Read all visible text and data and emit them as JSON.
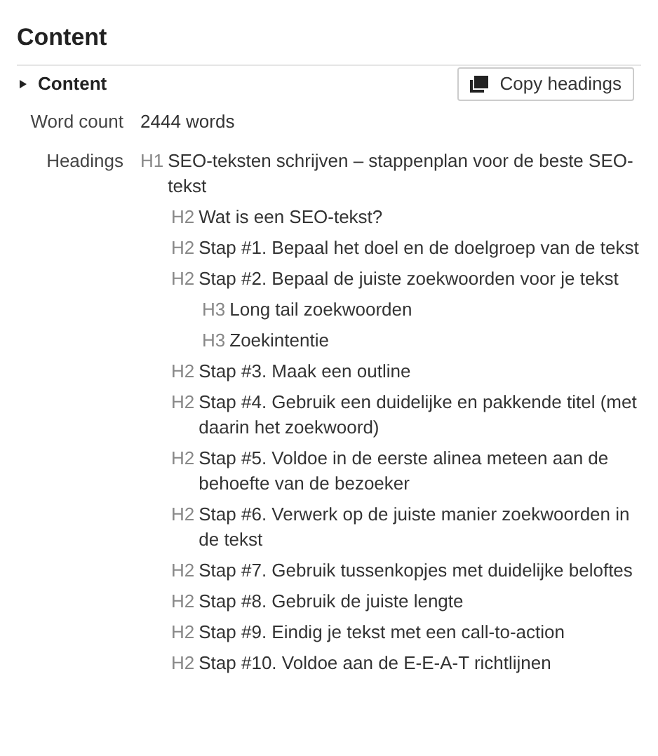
{
  "title": "Content",
  "section": {
    "title": "Content",
    "expanded": false,
    "copy_button": "Copy headings"
  },
  "word_count": {
    "label": "Word count",
    "value": "2444 words"
  },
  "headings": {
    "label": "Headings",
    "items": [
      {
        "tag": "H1",
        "text": "SEO-teksten schrijven – stappenplan voor de beste SEO-tekst",
        "children": [
          {
            "tag": "H2",
            "text": "Wat is een SEO-tekst?"
          },
          {
            "tag": "H2",
            "text": "Stap #1. Bepaal het doel en de doelgroep van de tekst"
          },
          {
            "tag": "H2",
            "text": "Stap #2. Bepaal de juiste zoekwoorden voor je tekst",
            "children": [
              {
                "tag": "H3",
                "text": "Long tail zoekwoorden"
              },
              {
                "tag": "H3",
                "text": "Zoekintentie"
              }
            ]
          },
          {
            "tag": "H2",
            "text": "Stap #3. Maak een outline"
          },
          {
            "tag": "H2",
            "text": "Stap #4. Gebruik een duidelijke en pakkende titel (met daarin het zoekwoord)"
          },
          {
            "tag": "H2",
            "text": "Stap #5. Voldoe in de eerste alinea meteen aan de behoefte van de bezoeker"
          },
          {
            "tag": "H2",
            "text": "Stap #6. Verwerk op de juiste manier zoekwoorden in de tekst"
          },
          {
            "tag": "H2",
            "text": "Stap #7. Gebruik tussenkopjes met duidelijke beloftes"
          },
          {
            "tag": "H2",
            "text": "Stap #8. Gebruik de juiste lengte"
          },
          {
            "tag": "H2",
            "text": "Stap #9. Eindig je tekst met een call-to-action"
          },
          {
            "tag": "H2",
            "text": "Stap #10. Voldoe aan de E-E-A-T richtlijnen"
          }
        ]
      }
    ]
  }
}
